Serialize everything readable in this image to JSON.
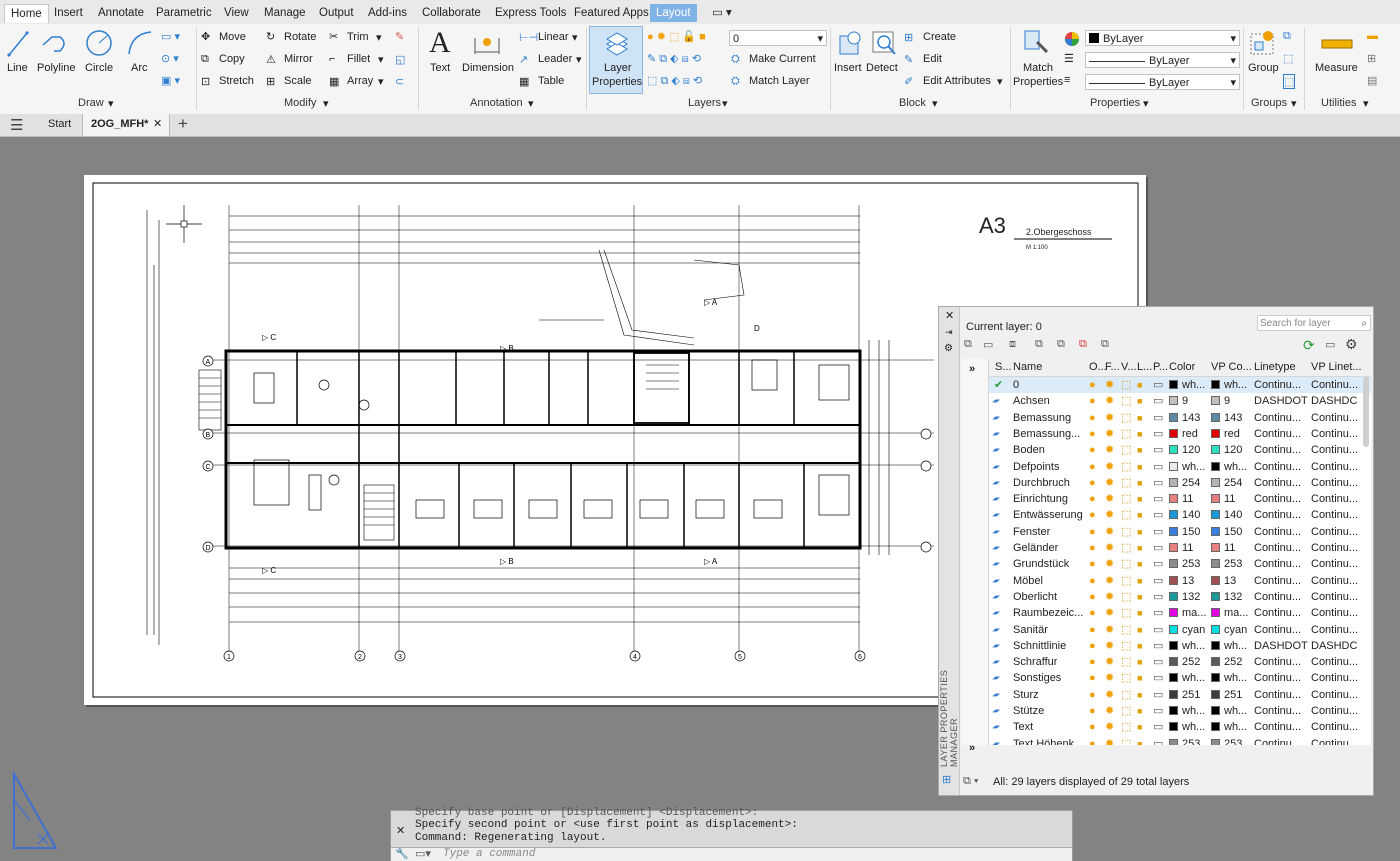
{
  "ribbon_tabs": [
    "Home",
    "Insert",
    "Annotate",
    "Parametric",
    "View",
    "Manage",
    "Output",
    "Add-ins",
    "Collaborate",
    "Express Tools",
    "Featured Apps",
    "Layout"
  ],
  "draw": {
    "line": "Line",
    "polyline": "Polyline",
    "circle": "Circle",
    "arc": "Arc",
    "title": "Draw"
  },
  "modify": {
    "move": "Move",
    "rotate": "Rotate",
    "trim": "Trim",
    "copy": "Copy",
    "mirror": "Mirror",
    "fillet": "Fillet",
    "stretch": "Stretch",
    "scale": "Scale",
    "array": "Array",
    "title": "Modify"
  },
  "annotation": {
    "text": "Text",
    "dimension": "Dimension",
    "linear": "Linear",
    "leader": "Leader",
    "table": "Table",
    "title": "Annotation"
  },
  "layers": {
    "layer_properties_1": "Layer",
    "layer_properties_2": "Properties",
    "current": "0",
    "make_current": "Make Current",
    "match_layer": "Match Layer",
    "title": "Layers"
  },
  "block": {
    "insert": "Insert",
    "detect": "Detect",
    "create": "Create",
    "edit": "Edit",
    "edit_attributes": "Edit Attributes",
    "title": "Block"
  },
  "properties": {
    "match_1": "Match",
    "match_2": "Properties",
    "color": "ByLayer",
    "linetype": "ByLayer",
    "lineweight": "ByLayer",
    "title": "Properties"
  },
  "groups": {
    "group": "Group",
    "title": "Groups"
  },
  "utilities": {
    "measure": "Measure",
    "title": "Utilities"
  },
  "doc_tabs": {
    "start": "Start",
    "file": "2OG_MFH*"
  },
  "drawing": {
    "sheet": "A3",
    "floor": "2.Obergeschoss",
    "scale": "M 1:100",
    "axis_rows": [
      "A",
      "B",
      "C",
      "D"
    ],
    "axis_cols": [
      "1",
      "2",
      "3",
      "4",
      "5",
      "6"
    ]
  },
  "layer_panel": {
    "current_layer": "Current layer: 0",
    "search_placeholder": "Search for layer",
    "side_title": "LAYER PROPERTIES MANAGER",
    "status": "All: 29 layers displayed of 29 total layers",
    "headers": {
      "s": "S...",
      "name": "Name",
      "o": "O...",
      "f": "F...",
      "v": "V...",
      "l": "L...",
      "p": "P...",
      "color": "Color",
      "vp_color": "VP Co...",
      "linetype": "Linetype",
      "vp_linetype": "VP Linet..."
    },
    "rows": [
      {
        "name": "0",
        "color": "wh...",
        "swatch": "#000000",
        "vp": "wh...",
        "vpswatch": "#000000",
        "lt": "Continu...",
        "vplt": "Continu...",
        "current": true
      },
      {
        "name": "Achsen",
        "color": "9",
        "swatch": "#c0c0c0",
        "vp": "9",
        "vpswatch": "#c0c0c0",
        "lt": "DASHDOT",
        "vplt": "DASHDC"
      },
      {
        "name": "Bemassung",
        "color": "143",
        "swatch": "#5e8aa3",
        "vp": "143",
        "vpswatch": "#5e8aa3",
        "lt": "Continu...",
        "vplt": "Continu..."
      },
      {
        "name": "Bemassung...",
        "color": "red",
        "swatch": "#e00000",
        "vp": "red",
        "vpswatch": "#e00000",
        "lt": "Continu...",
        "vplt": "Continu..."
      },
      {
        "name": "Boden",
        "color": "120",
        "swatch": "#2ce0c0",
        "vp": "120",
        "vpswatch": "#2ce0c0",
        "lt": "Continu...",
        "vplt": "Continu..."
      },
      {
        "name": "Defpoints",
        "color": "wh...",
        "swatch": "#e8e8e8",
        "vp": "wh...",
        "vpswatch": "#000000",
        "lt": "Continu...",
        "vplt": "Continu..."
      },
      {
        "name": "Durchbruch",
        "color": "254",
        "swatch": "#b4b4b4",
        "vp": "254",
        "vpswatch": "#b4b4b4",
        "lt": "Continu...",
        "vplt": "Continu..."
      },
      {
        "name": "Einrichtung",
        "color": "11",
        "swatch": "#e88080",
        "vp": "11",
        "vpswatch": "#e88080",
        "lt": "Continu...",
        "vplt": "Continu..."
      },
      {
        "name": "Entwässerung",
        "color": "140",
        "swatch": "#1a9ad8",
        "vp": "140",
        "vpswatch": "#1a9ad8",
        "lt": "Continu...",
        "vplt": "Continu..."
      },
      {
        "name": "Fenster",
        "color": "150",
        "swatch": "#3a7fe0",
        "vp": "150",
        "vpswatch": "#3a7fe0",
        "lt": "Continu...",
        "vplt": "Continu..."
      },
      {
        "name": "Geländer",
        "color": "11",
        "swatch": "#e88080",
        "vp": "11",
        "vpswatch": "#e88080",
        "lt": "Continu...",
        "vplt": "Continu..."
      },
      {
        "name": "Grundstück",
        "color": "253",
        "swatch": "#8c8c8c",
        "vp": "253",
        "vpswatch": "#8c8c8c",
        "lt": "Continu...",
        "vplt": "Continu..."
      },
      {
        "name": "Möbel",
        "color": "13",
        "swatch": "#a05050",
        "vp": "13",
        "vpswatch": "#a05050",
        "lt": "Continu...",
        "vplt": "Continu..."
      },
      {
        "name": "Oberlicht",
        "color": "132",
        "swatch": "#1a9a9a",
        "vp": "132",
        "vpswatch": "#1a9a9a",
        "lt": "Continu...",
        "vplt": "Continu..."
      },
      {
        "name": "Raumbezeic...",
        "color": "ma...",
        "swatch": "#e000e0",
        "vp": "ma...",
        "vpswatch": "#e000e0",
        "lt": "Continu...",
        "vplt": "Continu..."
      },
      {
        "name": "Sanitär",
        "color": "cyan",
        "swatch": "#00e0e0",
        "vp": "cyan",
        "vpswatch": "#00e0e0",
        "lt": "Continu...",
        "vplt": "Continu..."
      },
      {
        "name": "Schnittlinie",
        "color": "wh...",
        "swatch": "#000000",
        "vp": "wh...",
        "vpswatch": "#000000",
        "lt": "DASHDOT",
        "vplt": "DASHDC"
      },
      {
        "name": "Schraffur",
        "color": "252",
        "swatch": "#5a5a5a",
        "vp": "252",
        "vpswatch": "#5a5a5a",
        "lt": "Continu...",
        "vplt": "Continu..."
      },
      {
        "name": "Sonstiges",
        "color": "wh...",
        "swatch": "#000000",
        "vp": "wh...",
        "vpswatch": "#000000",
        "lt": "Continu...",
        "vplt": "Continu..."
      },
      {
        "name": "Sturz",
        "color": "251",
        "swatch": "#3c3c3c",
        "vp": "251",
        "vpswatch": "#3c3c3c",
        "lt": "Continu...",
        "vplt": "Continu..."
      },
      {
        "name": "Stütze",
        "color": "wh...",
        "swatch": "#000000",
        "vp": "wh...",
        "vpswatch": "#000000",
        "lt": "Continu...",
        "vplt": "Continu..."
      },
      {
        "name": "Text",
        "color": "wh...",
        "swatch": "#000000",
        "vp": "wh...",
        "vpswatch": "#000000",
        "lt": "Continu...",
        "vplt": "Continu..."
      },
      {
        "name": "Text Höhenk...",
        "color": "253",
        "swatch": "#8c8c8c",
        "vp": "253",
        "vpswatch": "#8c8c8c",
        "lt": "Continu...",
        "vplt": "Continu..."
      }
    ]
  },
  "command": {
    "line1": "Specify base point or [Displacement] <Displacement>:",
    "line2": "Specify second point or <use first point as displacement>:",
    "line3": "Command: Regenerating layout.",
    "placeholder": "Type a command"
  },
  "colors": {
    "accent": "#2f7fd0",
    "layout_tab": "#7fb2e5",
    "bulb": "#f0a000",
    "current_check": "#2a9d3a"
  }
}
